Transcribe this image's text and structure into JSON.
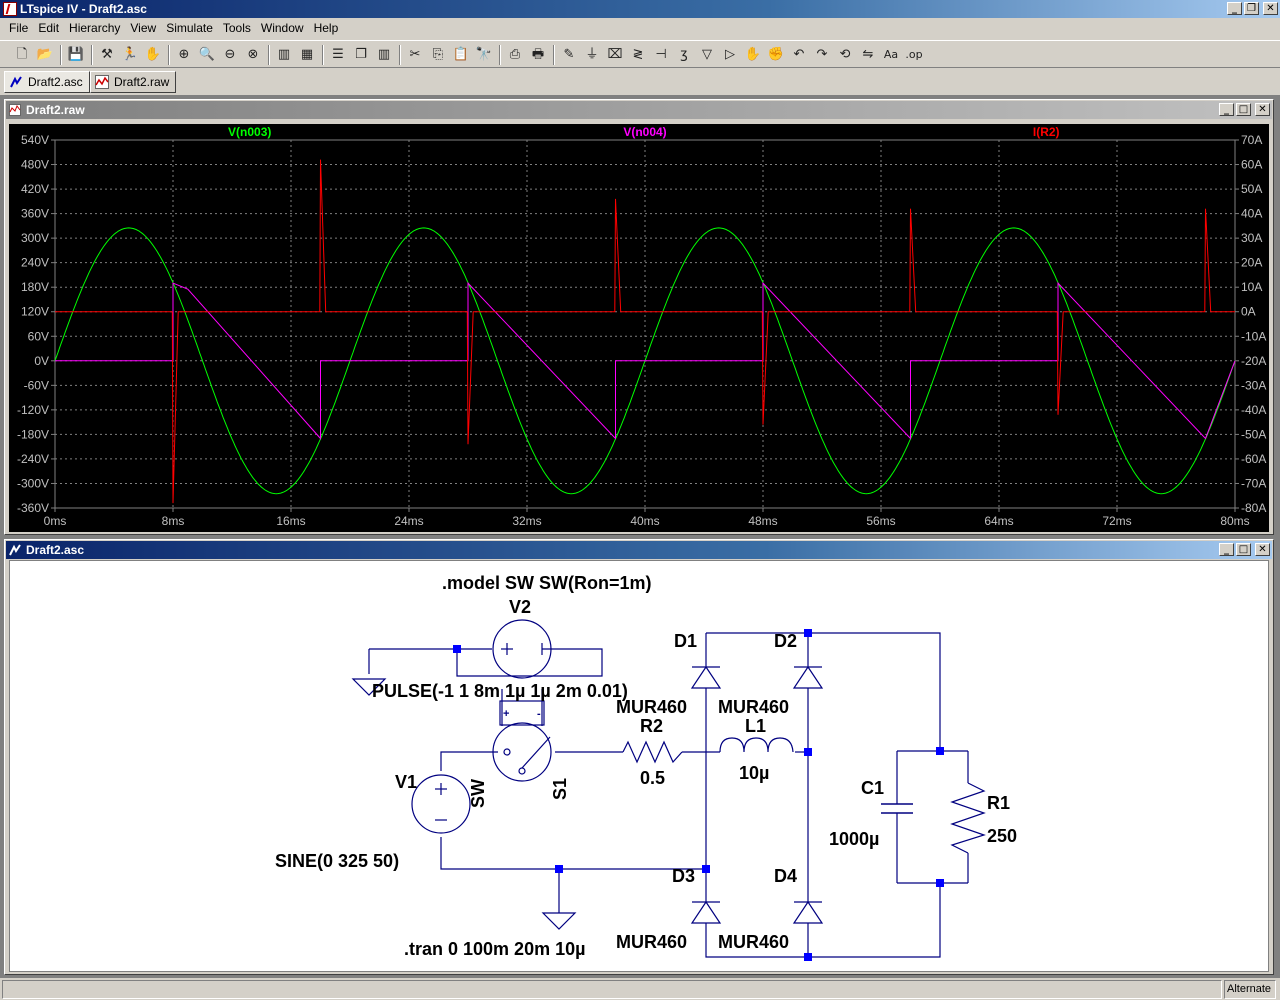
{
  "app": {
    "title": "LTspice IV - Draft2.asc"
  },
  "menu": [
    "File",
    "Edit",
    "Hierarchy",
    "View",
    "Simulate",
    "Tools",
    "Window",
    "Help"
  ],
  "toolbar": {
    "icons": [
      "new-schematic-icon",
      "open-icon",
      "save-icon",
      "control-panel-icon",
      "run-icon",
      "halt-icon",
      "zoom-in-icon",
      "zoom-pan-icon",
      "zoom-out-icon",
      "zoom-fit-icon",
      "autorange-icon",
      "grid-icon",
      "tile-horizontal-icon",
      "cascade-icon",
      "tile-vertical-icon",
      "cut-icon",
      "copy-icon",
      "paste-icon",
      "find-icon",
      "print-setup-icon",
      "print-icon",
      "wire-icon",
      "ground-icon",
      "label-icon",
      "resistor-icon",
      "capacitor-icon",
      "inductor-icon",
      "diode-icon",
      "component-icon",
      "move-icon",
      "drag-icon",
      "undo-icon",
      "redo-icon",
      "rotate-icon",
      "mirror-icon",
      "text-icon",
      "spice-directive-icon"
    ]
  },
  "tabs": [
    {
      "label": "Draft2.asc",
      "icon": "schematic-icon",
      "active": true
    },
    {
      "label": "Draft2.raw",
      "icon": "waveform-icon",
      "active": false
    }
  ],
  "waveform_window": {
    "title": "Draft2.raw"
  },
  "schematic_window": {
    "title": "Draft2.asc"
  },
  "chart_data": {
    "type": "line",
    "title": "",
    "xlabel": "",
    "x_ticks": [
      "0ms",
      "8ms",
      "16ms",
      "24ms",
      "32ms",
      "40ms",
      "48ms",
      "56ms",
      "64ms",
      "72ms",
      "80ms"
    ],
    "xlim": [
      0,
      80
    ],
    "x_unit": "ms",
    "left_axis": {
      "ticks": [
        "540V",
        "480V",
        "420V",
        "360V",
        "300V",
        "240V",
        "180V",
        "120V",
        "60V",
        "0V",
        "-60V",
        "-120V",
        "-180V",
        "-240V",
        "-300V",
        "-360V"
      ],
      "ylim": [
        -360,
        540
      ]
    },
    "right_axis": {
      "ticks": [
        "70A",
        "60A",
        "50A",
        "40A",
        "30A",
        "20A",
        "10A",
        "0A",
        "-10A",
        "-20A",
        "-30A",
        "-40A",
        "-50A",
        "-60A",
        "-70A",
        "-80A"
      ],
      "ylim": [
        -80,
        70
      ]
    },
    "grid": true,
    "legend": "top",
    "background": "#000000",
    "series": [
      {
        "name": "V(n003)",
        "color": "#00ff00",
        "axis": "left",
        "kind": "sine",
        "amplitude": 325,
        "frequency_hz": 50
      },
      {
        "name": "V(n004)",
        "color": "#ff00ff",
        "axis": "left",
        "kind": "switched-sine",
        "switch_windows_ms": [
          [
            8,
            18
          ],
          [
            28,
            38
          ],
          [
            48,
            58
          ],
          [
            68,
            78
          ]
        ],
        "points": [
          [
            0,
            0
          ],
          [
            8,
            0
          ],
          [
            8,
            190
          ],
          [
            9,
            175
          ],
          [
            18,
            -190
          ],
          [
            18,
            0
          ],
          [
            28,
            0
          ],
          [
            28,
            190
          ],
          [
            38,
            -190
          ],
          [
            38,
            0
          ],
          [
            48,
            0
          ],
          [
            48,
            190
          ],
          [
            58,
            -190
          ],
          [
            58,
            0
          ],
          [
            68,
            0
          ],
          [
            68,
            190
          ],
          [
            78,
            -190
          ],
          [
            80,
            0
          ]
        ]
      },
      {
        "name": "I(R2)",
        "color": "#ff0000",
        "axis": "right",
        "kind": "spikes",
        "baseline": 0,
        "spikes": [
          [
            8,
            -78
          ],
          [
            18,
            62
          ],
          [
            28,
            -54
          ],
          [
            38,
            46
          ],
          [
            48,
            -46
          ],
          [
            58,
            42
          ],
          [
            68,
            -42
          ],
          [
            78,
            42
          ]
        ]
      }
    ]
  },
  "schematic": {
    "labels": {
      "model": ".model SW SW(Ron=1m)",
      "v2": "V2",
      "pulse": "PULSE(-1 1 8m 1µ 1µ 2m 0.01)",
      "v1": "V1",
      "sine": "SINE(0 325 50)",
      "sw_model": "SW",
      "s1": "S1",
      "r2": "R2",
      "r2_val": "0.5",
      "l1": "L1",
      "l1_val": "10µ",
      "d1": "D1",
      "d1_model": "MUR460",
      "d2": "D2",
      "d2_model": "MUR460",
      "d3": "D3",
      "d3_model": "MUR460",
      "d4": "D4",
      "d4_model": "MUR460",
      "c1": "C1",
      "c1_val": "1000µ",
      "r1": "R1",
      "r1_val": "250",
      "tran": ".tran 0 100m 20m 10µ"
    },
    "wire_color": "#000080",
    "component_color": "#000080",
    "node_color": "#0000ff"
  },
  "statusbar": {
    "mode": "Alternate"
  }
}
